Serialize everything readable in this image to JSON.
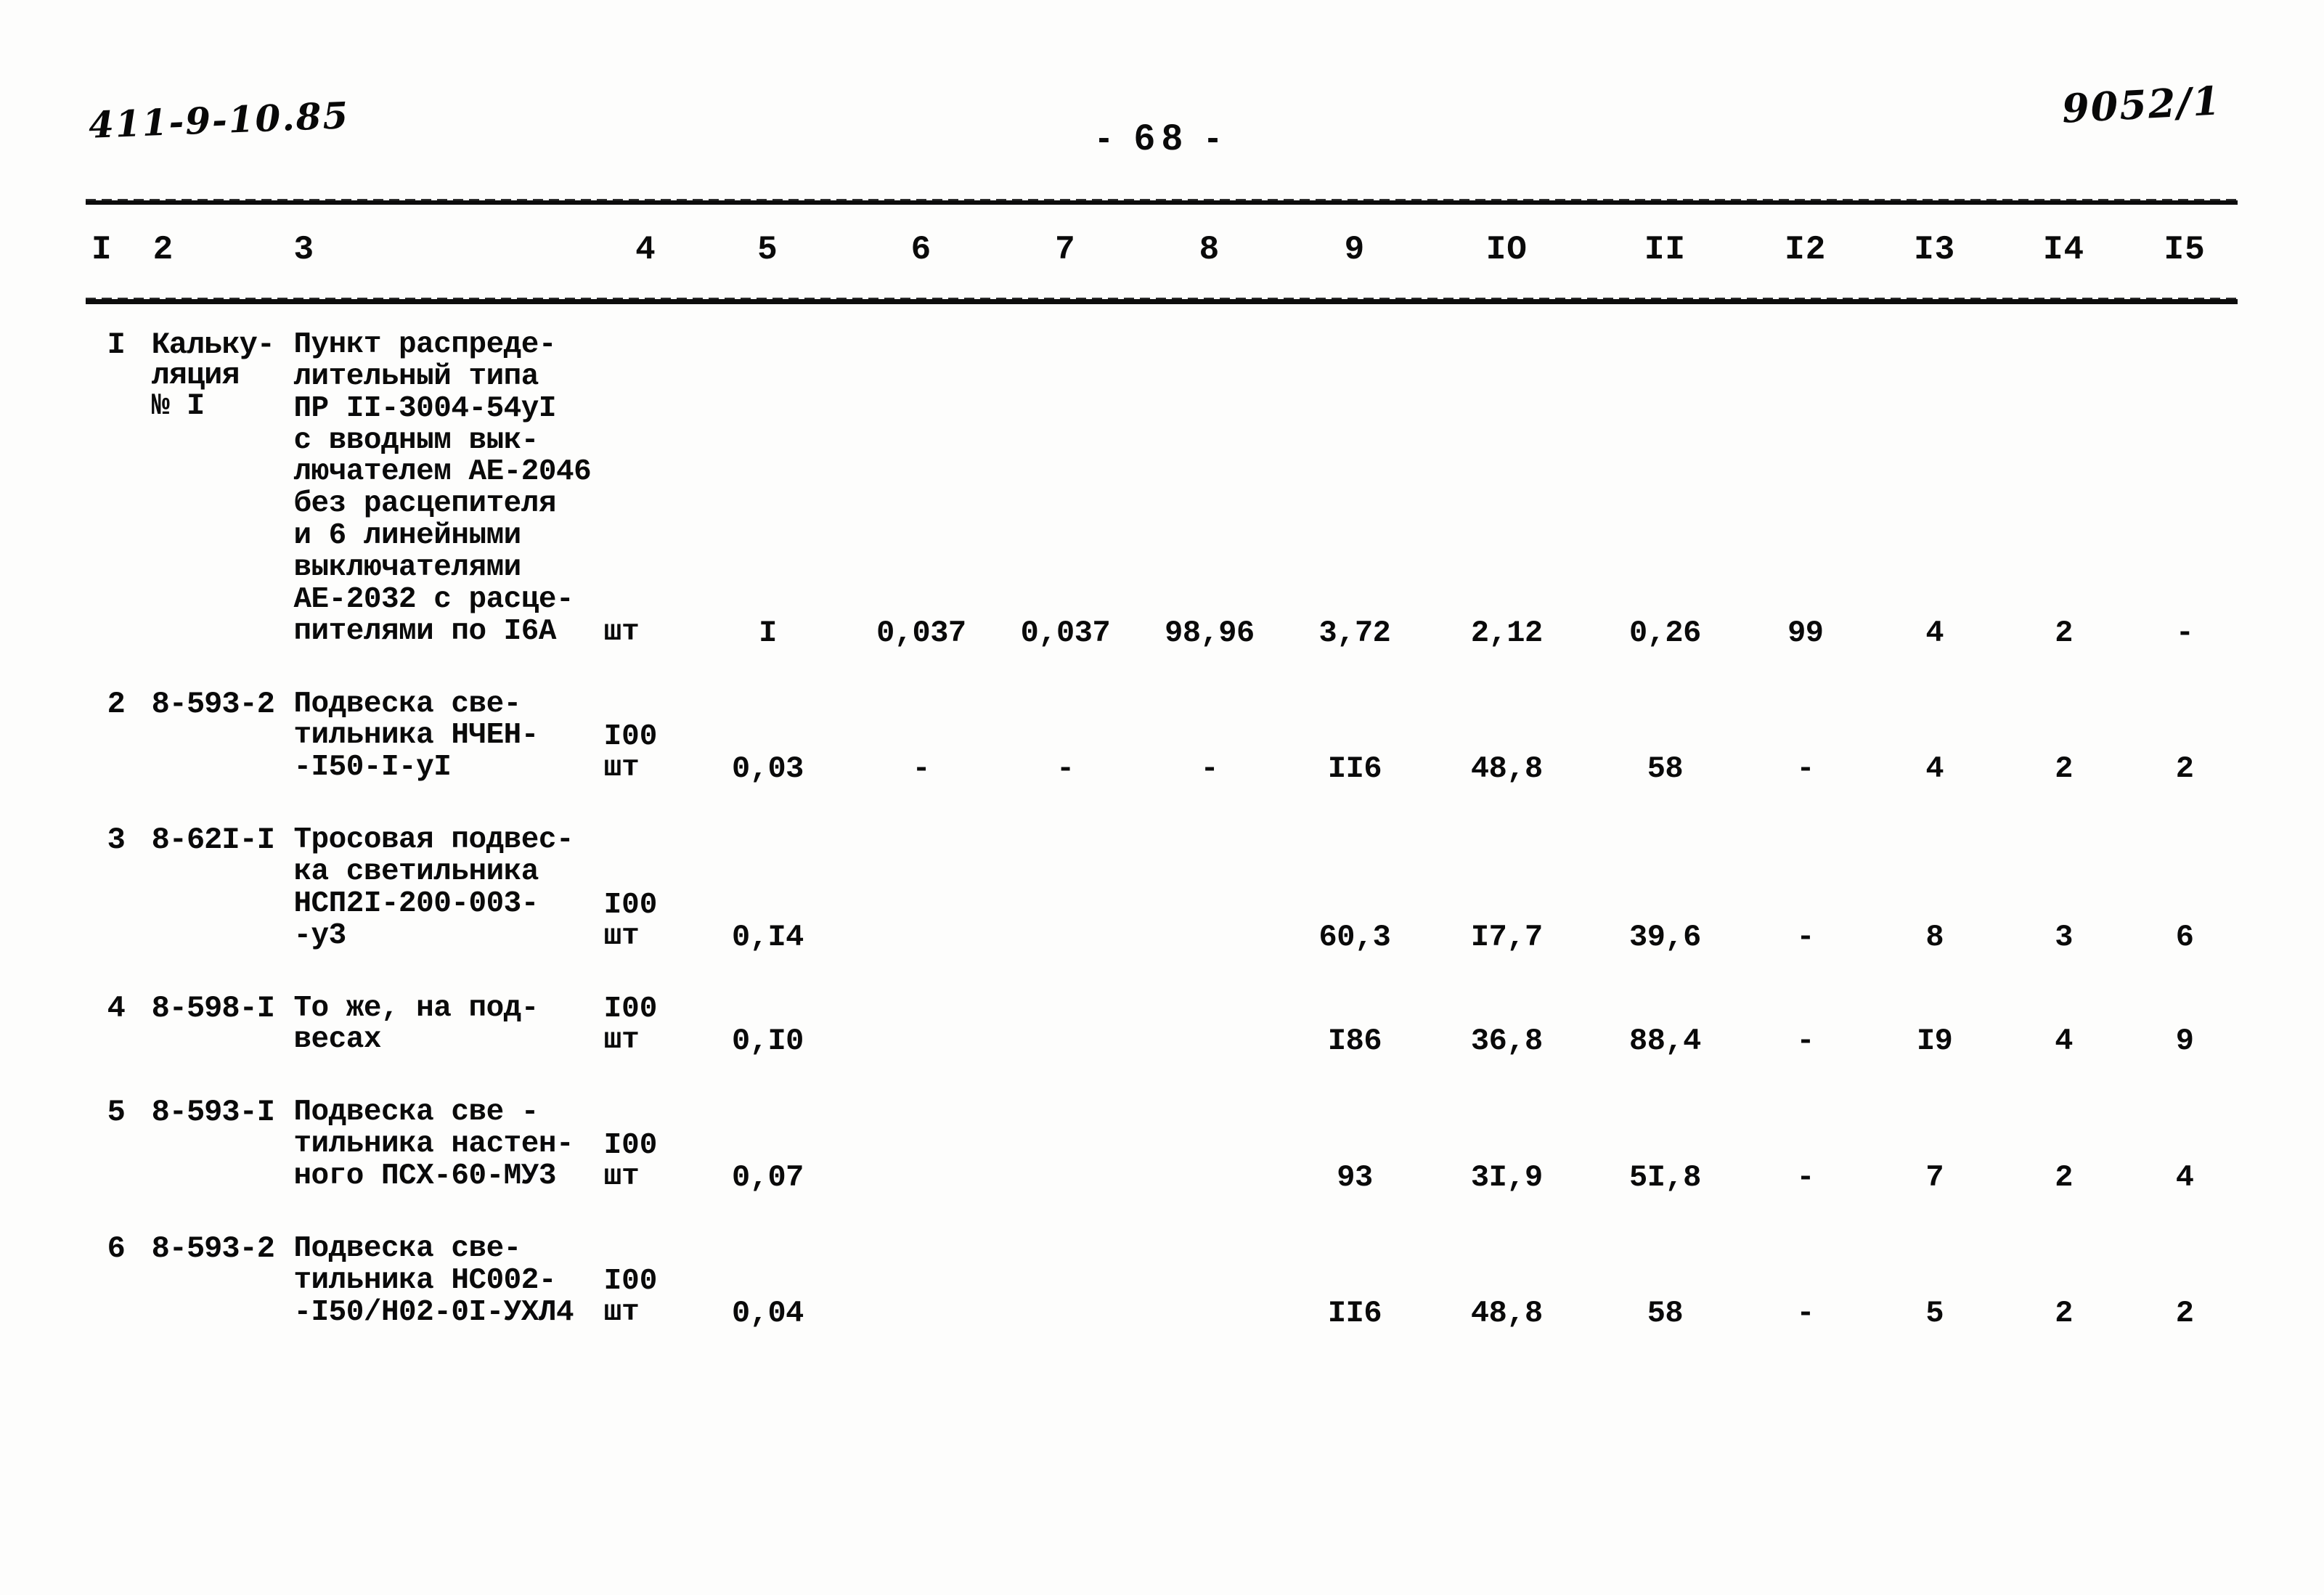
{
  "marginalia": {
    "top_left_stamp": "411-9-10.85",
    "top_right_stamp": "9052/1"
  },
  "page_number": "- 68 -",
  "table": {
    "column_headers": [
      "I",
      "2",
      "3",
      "4",
      "5",
      "6",
      "7",
      "8",
      "9",
      "IO",
      "II",
      "I2",
      "I3",
      "I4",
      "I5"
    ],
    "rows": [
      {
        "index": "I",
        "code": "Кальку-\nляция\n№ I",
        "code_lines": [
          "Кальку-",
          "ляция",
          "№ I"
        ],
        "description_lines": [
          "Пункт распреде-",
          "лительный типа",
          "ПР II-3004-54уI",
          "с вводным вык-",
          "лючателем АЕ-2046",
          "без расцепителя",
          "и 6 линейными",
          "выключателями",
          "АЕ-2032 с расце-",
          "пителями по I6А"
        ],
        "unit_lines": [
          "шт"
        ],
        "values": {
          "c5": "I",
          "c6": "0,037",
          "c7": "0,037",
          "c8": "98,96",
          "c9": "3,72",
          "c10": "2,12",
          "c11": "0,26",
          "c12": "99",
          "c13": "4",
          "c14": "2",
          "c15": "-"
        }
      },
      {
        "index": "2",
        "code_lines": [
          "8-593-2"
        ],
        "description_lines": [
          "Подвеска све-",
          "тильника НЧЕН-",
          "-I50-I-уI"
        ],
        "unit_lines": [
          "I00",
          "шт"
        ],
        "values": {
          "c5": "0,03",
          "c6": "-",
          "c7": "-",
          "c8": "-",
          "c9": "II6",
          "c10": "48,8",
          "c11": "58",
          "c12": "-",
          "c13": "4",
          "c14": "2",
          "c15": "2"
        }
      },
      {
        "index": "3",
        "code_lines": [
          "8-62I-I"
        ],
        "description_lines": [
          "Тросовая подвес-",
          "ка светильника",
          "НСП2I-200-003-",
          "-у3"
        ],
        "unit_lines": [
          "I00",
          "шт"
        ],
        "values": {
          "c5": "0,I4",
          "c6": "",
          "c7": "",
          "c8": "",
          "c9": "60,3",
          "c10": "I7,7",
          "c11": "39,6",
          "c12": "-",
          "c13": "8",
          "c14": "3",
          "c15": "6"
        }
      },
      {
        "index": "4",
        "code_lines": [
          "8-598-I"
        ],
        "description_lines": [
          "То же, на под-",
          "весах"
        ],
        "unit_lines": [
          "I00",
          "шт"
        ],
        "values": {
          "c5": "0,I0",
          "c6": "",
          "c7": "",
          "c8": "",
          "c9": "I86",
          "c10": "36,8",
          "c11": "88,4",
          "c12": "-",
          "c13": "I9",
          "c14": "4",
          "c15": "9"
        }
      },
      {
        "index": "5",
        "code_lines": [
          "8-593-I"
        ],
        "description_lines": [
          "Подвеска све -",
          "тильника настен-",
          "ного ПСХ-60-МУ3"
        ],
        "unit_lines": [
          "I00",
          "шт"
        ],
        "values": {
          "c5": "0,07",
          "c6": "",
          "c7": "",
          "c8": "",
          "c9": "93",
          "c10": "3I,9",
          "c11": "5I,8",
          "c12": "-",
          "c13": "7",
          "c14": "2",
          "c15": "4"
        }
      },
      {
        "index": "6",
        "code_lines": [
          "8-593-2"
        ],
        "description_lines": [
          "Подвеска све-",
          "тильника НС002-",
          "-I50/Н02-0I-УХЛ4"
        ],
        "unit_lines": [
          "I00",
          "шт"
        ],
        "values": {
          "c5": "0,04",
          "c6": "",
          "c7": "",
          "c8": "",
          "c9": "II6",
          "c10": "48,8",
          "c11": "58",
          "c12": "-",
          "c13": "5",
          "c14": "2",
          "c15": "2"
        }
      }
    ]
  }
}
